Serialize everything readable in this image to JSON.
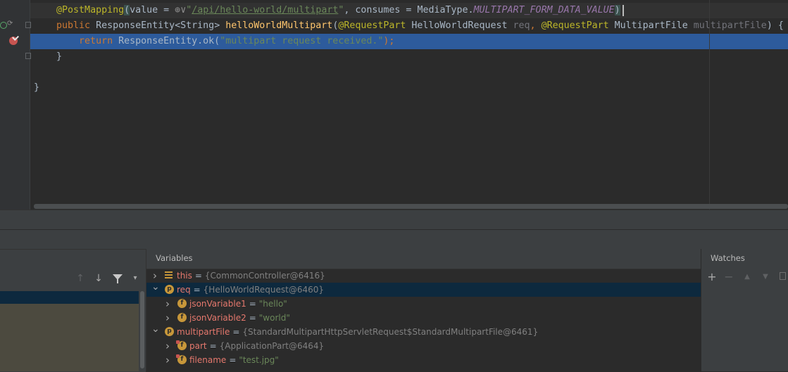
{
  "editor": {
    "line1": {
      "annotation": "@PostMapping",
      "open": "(",
      "value_kw": "value = ",
      "globe": "⊕",
      "chev": "∨",
      "quote1": "\"",
      "url": "/api/hello-world/multipart",
      "quote2": "\"",
      "consumes": ", consumes = MediaType.",
      "const": "MULTIPART_FORM_DATA_VALUE",
      "close": ")"
    },
    "line2": {
      "kw": "public ",
      "type": "ResponseEntity<String> ",
      "method": "helloWorldMultipart",
      "p1": "(",
      "ann1": "@RequestPart",
      "t1": " HelloWorldRequest ",
      "n1": "req",
      "comma": ", ",
      "ann2": "@RequestPart",
      "t2": " MultipartFile ",
      "n2": "multipartFile",
      "end": ") {"
    },
    "line3": {
      "kw": "return ",
      "call": "ResponseEntity.ok(",
      "str": "\"multipart request received.\"",
      "end": ");"
    },
    "line4": "}",
    "line5": "}"
  },
  "debugger": {
    "variables_title": "Variables",
    "watches_title": "Watches",
    "frame_tools": [
      "↑",
      "↓",
      "filter-icon",
      "▾"
    ],
    "watch_tools": [
      "+",
      "−",
      "▲",
      "▼",
      "copy-icon"
    ],
    "variables": [
      {
        "indent": 0,
        "expanded": false,
        "icon": "list-icon",
        "name": "this",
        "value": "{CommonController@6416}",
        "selected": false
      },
      {
        "indent": 0,
        "expanded": true,
        "icon": "p",
        "name": "req",
        "value": "{HelloWorldRequest@6460}",
        "selected": true
      },
      {
        "indent": 1,
        "expanded": false,
        "icon": "f",
        "name": "jsonVariable1",
        "value": "\"hello\"",
        "selected": false,
        "is_string": true
      },
      {
        "indent": 1,
        "expanded": false,
        "icon": "f",
        "name": "jsonVariable2",
        "value": "\"world\"",
        "selected": false,
        "is_string": true
      },
      {
        "indent": 0,
        "expanded": true,
        "icon": "p",
        "name": "multipartFile",
        "value": "{StandardMultipartHttpServletRequest$StandardMultipartFile@6461}",
        "selected": false
      },
      {
        "indent": 1,
        "expanded": false,
        "icon": "f-lock",
        "name": "part",
        "value": "{ApplicationPart@6464}",
        "selected": false
      },
      {
        "indent": 1,
        "expanded": false,
        "icon": "f-lock",
        "name": "filename",
        "value": "\"test.jpg\"",
        "selected": false,
        "is_string": true
      }
    ]
  },
  "colors": {
    "editor_bg": "#2b2b2b",
    "selection": "#2d5b9c",
    "var_selected": "#0d293e",
    "badge": "#c7973a"
  }
}
